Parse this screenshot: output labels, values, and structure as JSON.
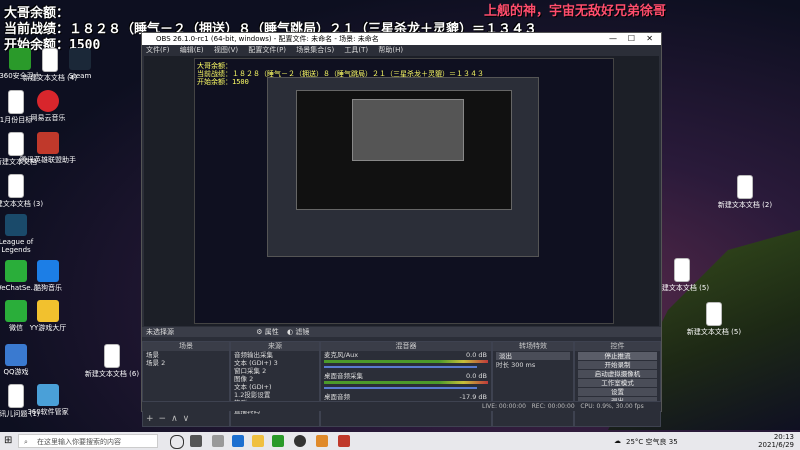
{
  "overlay": {
    "line1": "大哥余额：",
    "line2": "当前战绩：１８２８（睡气－２（拥送）８（睡气跳局）２１（三星杀龙＋灵貔）＝１３４３",
    "line3": "开始余额：1500",
    "right": "上舰的神，宇宙无敌好兄弟徐哥"
  },
  "desktop_icons": [
    {
      "label": "360安全卫士",
      "color": "#2a9a2a"
    },
    {
      "label": "新建文本文档 (4)",
      "color": "#ffffff"
    },
    {
      "label": "Steam",
      "color": "#1b2838"
    },
    {
      "label": "1月份目标",
      "color": "#ffffff"
    },
    {
      "label": "网易云音乐",
      "color": "#d8262c"
    },
    {
      "label": "新建文本文档",
      "color": "#ffffff"
    },
    {
      "label": "腾讯英雄联盟助手",
      "color": "#c0392b"
    },
    {
      "label": "新建文本文档 (3)",
      "color": "#ffffff"
    },
    {
      "label": "League of Legends",
      "color": "#1a4a6a"
    },
    {
      "label": "WeChatSe...",
      "color": "#2aae3a"
    },
    {
      "label": "酷狗音乐",
      "color": "#1c7ee6"
    },
    {
      "label": "微信",
      "color": "#2aae3a"
    },
    {
      "label": "YY游戏大厅",
      "color": "#f2c12e"
    },
    {
      "label": "QQ游戏",
      "color": "#3a7ad0"
    },
    {
      "label": "新建文本文档 (6)",
      "color": "#ffffff"
    },
    {
      "label": "腾讯儿问题 (1)",
      "color": "#ffffff"
    },
    {
      "label": "360软件管家",
      "color": "#4aa0d8"
    }
  ],
  "right_icons": [
    {
      "label": "新建文本文档 (2)"
    },
    {
      "label": "新建文本文档 (5)"
    },
    {
      "label": "新建文本文档 (5)"
    }
  ],
  "obs": {
    "title": "OBS 26.1.0-rc1 (64-bit, windows) - 配置文件: 未命名 - 场景: 未命名",
    "menu": [
      "文件(F)",
      "编辑(E)",
      "视图(V)",
      "配置文件(P)",
      "场景集合(S)",
      "工具(T)",
      "帮助(H)"
    ],
    "source_bar": "未选择源",
    "props_label": "属性",
    "filters_label": "滤镜",
    "scenes": {
      "header": "场景",
      "items": [
        "场景",
        "场景 2"
      ]
    },
    "sources": {
      "header": "来源",
      "items": [
        "音频输出采集",
        "文本 (GDI+) 3",
        "窗口采集 2",
        "图像 2",
        "文本 (GDI+)",
        "1.2投影设置",
        "钩群",
        "直播转码",
        "视频采集设备"
      ]
    },
    "mixer": {
      "header": "混音器",
      "channels": [
        {
          "name": "麦克风/Aux",
          "db": "0.0 dB",
          "level": 0.7
        },
        {
          "name": "桌面音频采集",
          "db": "0.0 dB",
          "level": 0.6
        },
        {
          "name": "桌面音频",
          "db": "-17.9 dB",
          "level": 0.3
        }
      ]
    },
    "transitions": {
      "header": "转场特效",
      "type": "淡出",
      "duration_label": "时长",
      "duration": "300 ms"
    },
    "controls": {
      "header": "控件",
      "buttons": [
        "停止推流",
        "开始录制",
        "启动虚拟摄像机",
        "工作室模式",
        "设置",
        "退出"
      ]
    },
    "status": {
      "live": "LIVE: 00:00:00",
      "rec": "REC: 00:00:00",
      "cpu": "CPU: 0.9%, 30.00 fps"
    }
  },
  "taskbar": {
    "search_placeholder": "在这里输入你要搜索的内容",
    "weather": "25°C 空气良 35",
    "time": "20:13",
    "date": "2021/6/29"
  }
}
